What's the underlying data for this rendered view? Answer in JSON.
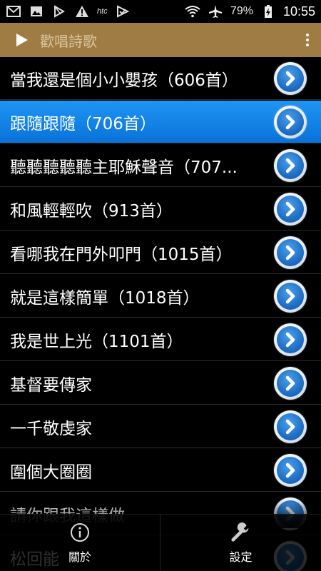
{
  "status_bar": {
    "left_icons": [
      "gmail-icon",
      "image-icon",
      "play-store-icon",
      "warning-icon",
      "htc-icon",
      "check-icon"
    ],
    "htc_text": "htc",
    "battery_percent": "79%",
    "time": "10:55"
  },
  "app_bar": {
    "title": "歡唱詩歌",
    "accent_color": "#a07c45"
  },
  "songs": [
    {
      "title": "當我還是個小小嬰孩（606首）",
      "selected": false
    },
    {
      "title": "跟隨跟隨（706首）",
      "selected": true
    },
    {
      "title": "聽聽聽聽聽主耶穌聲音（707...",
      "selected": false
    },
    {
      "title": "和風輕輕吹（913首）",
      "selected": false
    },
    {
      "title": "看哪我在門外叩門（1015首）",
      "selected": false
    },
    {
      "title": "就是這樣簡單（1018首）",
      "selected": false
    },
    {
      "title": "我是世上光（1101首）",
      "selected": false
    },
    {
      "title": "基督要傳家",
      "selected": false
    },
    {
      "title": "一千敬虔家",
      "selected": false
    },
    {
      "title": "圍個大圈圈",
      "selected": false
    },
    {
      "title": "請你跟我這樣做",
      "selected": false
    },
    {
      "title": "松回能",
      "selected": false
    }
  ],
  "bottom_bar": {
    "about_label": "關於",
    "settings_label": "設定"
  },
  "colors": {
    "selected_row": "#1a86ee",
    "background": "#000000"
  }
}
